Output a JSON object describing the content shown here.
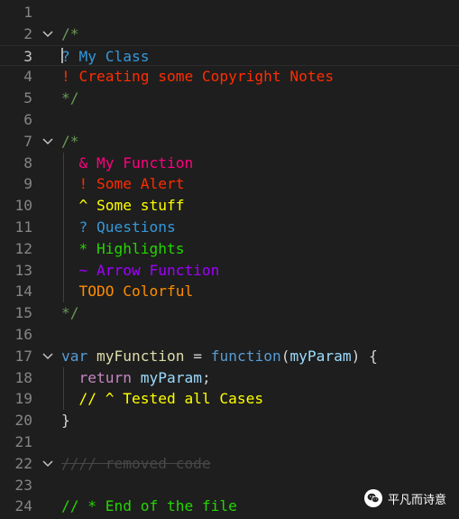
{
  "editor": {
    "colors": {
      "background": "#1e1e1e",
      "line_number": "#858585",
      "comment_green": "#6a9955",
      "question_blue": "#3498db",
      "alert_red": "#ff2d00",
      "highlight_pink": "#ff0080",
      "todo_orange": "#ff8c00",
      "warning_yellow": "#ffff00",
      "highlight_green": "#23d500",
      "arrow_purple": "#a100ff",
      "keyword_blue": "#569cd6",
      "control_purple": "#c586c0",
      "variable_lightblue": "#9cdcfe",
      "function_yellow": "#dcdcaa",
      "strike_gray": "#474747"
    },
    "lines": [
      {
        "number": "1",
        "fold": false,
        "tokens": []
      },
      {
        "number": "2",
        "fold": true,
        "tokens": [
          {
            "text": "/*",
            "color": "#6a9955"
          }
        ]
      },
      {
        "number": "3",
        "fold": false,
        "current": true,
        "tokens": [
          {
            "text": "? My Class",
            "color": "#3498db"
          }
        ]
      },
      {
        "number": "4",
        "fold": false,
        "tokens": [
          {
            "text": "! Creating some Copyright Notes",
            "color": "#ff2d00"
          }
        ]
      },
      {
        "number": "5",
        "fold": false,
        "tokens": [
          {
            "text": "*/",
            "color": "#6a9955"
          }
        ]
      },
      {
        "number": "6",
        "fold": false,
        "tokens": []
      },
      {
        "number": "7",
        "fold": true,
        "tokens": [
          {
            "text": "/*",
            "color": "#6a9955"
          }
        ]
      },
      {
        "number": "8",
        "fold": false,
        "tokens": [
          {
            "text": "  & My Function",
            "color": "#ff0080"
          }
        ]
      },
      {
        "number": "9",
        "fold": false,
        "tokens": [
          {
            "text": "  ! Some Alert",
            "color": "#ff2d00"
          }
        ]
      },
      {
        "number": "10",
        "fold": false,
        "tokens": [
          {
            "text": "  ^ Some stuff",
            "color": "#ffff00"
          }
        ]
      },
      {
        "number": "11",
        "fold": false,
        "tokens": [
          {
            "text": "  ? Questions",
            "color": "#3498db"
          }
        ]
      },
      {
        "number": "12",
        "fold": false,
        "tokens": [
          {
            "text": "  * Highlights",
            "color": "#23d500"
          }
        ]
      },
      {
        "number": "13",
        "fold": false,
        "tokens": [
          {
            "text": "  ~ Arrow Function",
            "color": "#a100ff"
          }
        ]
      },
      {
        "number": "14",
        "fold": false,
        "tokens": [
          {
            "text": "  TODO Colorful",
            "color": "#ff8c00"
          }
        ]
      },
      {
        "number": "15",
        "fold": false,
        "tokens": [
          {
            "text": "*/",
            "color": "#6a9955"
          }
        ]
      },
      {
        "number": "16",
        "fold": false,
        "tokens": []
      },
      {
        "number": "17",
        "fold": true,
        "tokens": [
          {
            "text": "var",
            "color": "#569cd6"
          },
          {
            "text": " ",
            "color": "#d4d4d4"
          },
          {
            "text": "myFunction",
            "color": "#dcdcaa"
          },
          {
            "text": " = ",
            "color": "#d4d4d4"
          },
          {
            "text": "function",
            "color": "#569cd6"
          },
          {
            "text": "(",
            "color": "#d4d4d4"
          },
          {
            "text": "myParam",
            "color": "#9cdcfe"
          },
          {
            "text": ") {",
            "color": "#d4d4d4"
          }
        ]
      },
      {
        "number": "18",
        "fold": false,
        "tokens": [
          {
            "text": "  ",
            "color": "#d4d4d4"
          },
          {
            "text": "return",
            "color": "#c586c0"
          },
          {
            "text": " ",
            "color": "#d4d4d4"
          },
          {
            "text": "myParam",
            "color": "#9cdcfe"
          },
          {
            "text": ";",
            "color": "#d4d4d4"
          }
        ]
      },
      {
        "number": "19",
        "fold": false,
        "tokens": [
          {
            "text": "  // ^ Tested all Cases",
            "color": "#ffff00"
          }
        ]
      },
      {
        "number": "20",
        "fold": false,
        "tokens": [
          {
            "text": "}",
            "color": "#d4d4d4"
          }
        ]
      },
      {
        "number": "21",
        "fold": false,
        "tokens": []
      },
      {
        "number": "22",
        "fold": true,
        "tokens": [
          {
            "text": "//// removed code",
            "color": "#474747",
            "strike": true
          }
        ]
      },
      {
        "number": "23",
        "fold": false,
        "tokens": []
      },
      {
        "number": "24",
        "fold": false,
        "tokens": [
          {
            "text": "// * End of the file",
            "color": "#23d500"
          }
        ]
      }
    ]
  },
  "watermark": {
    "icon": "wechat-icon",
    "text": "平凡而诗意"
  }
}
